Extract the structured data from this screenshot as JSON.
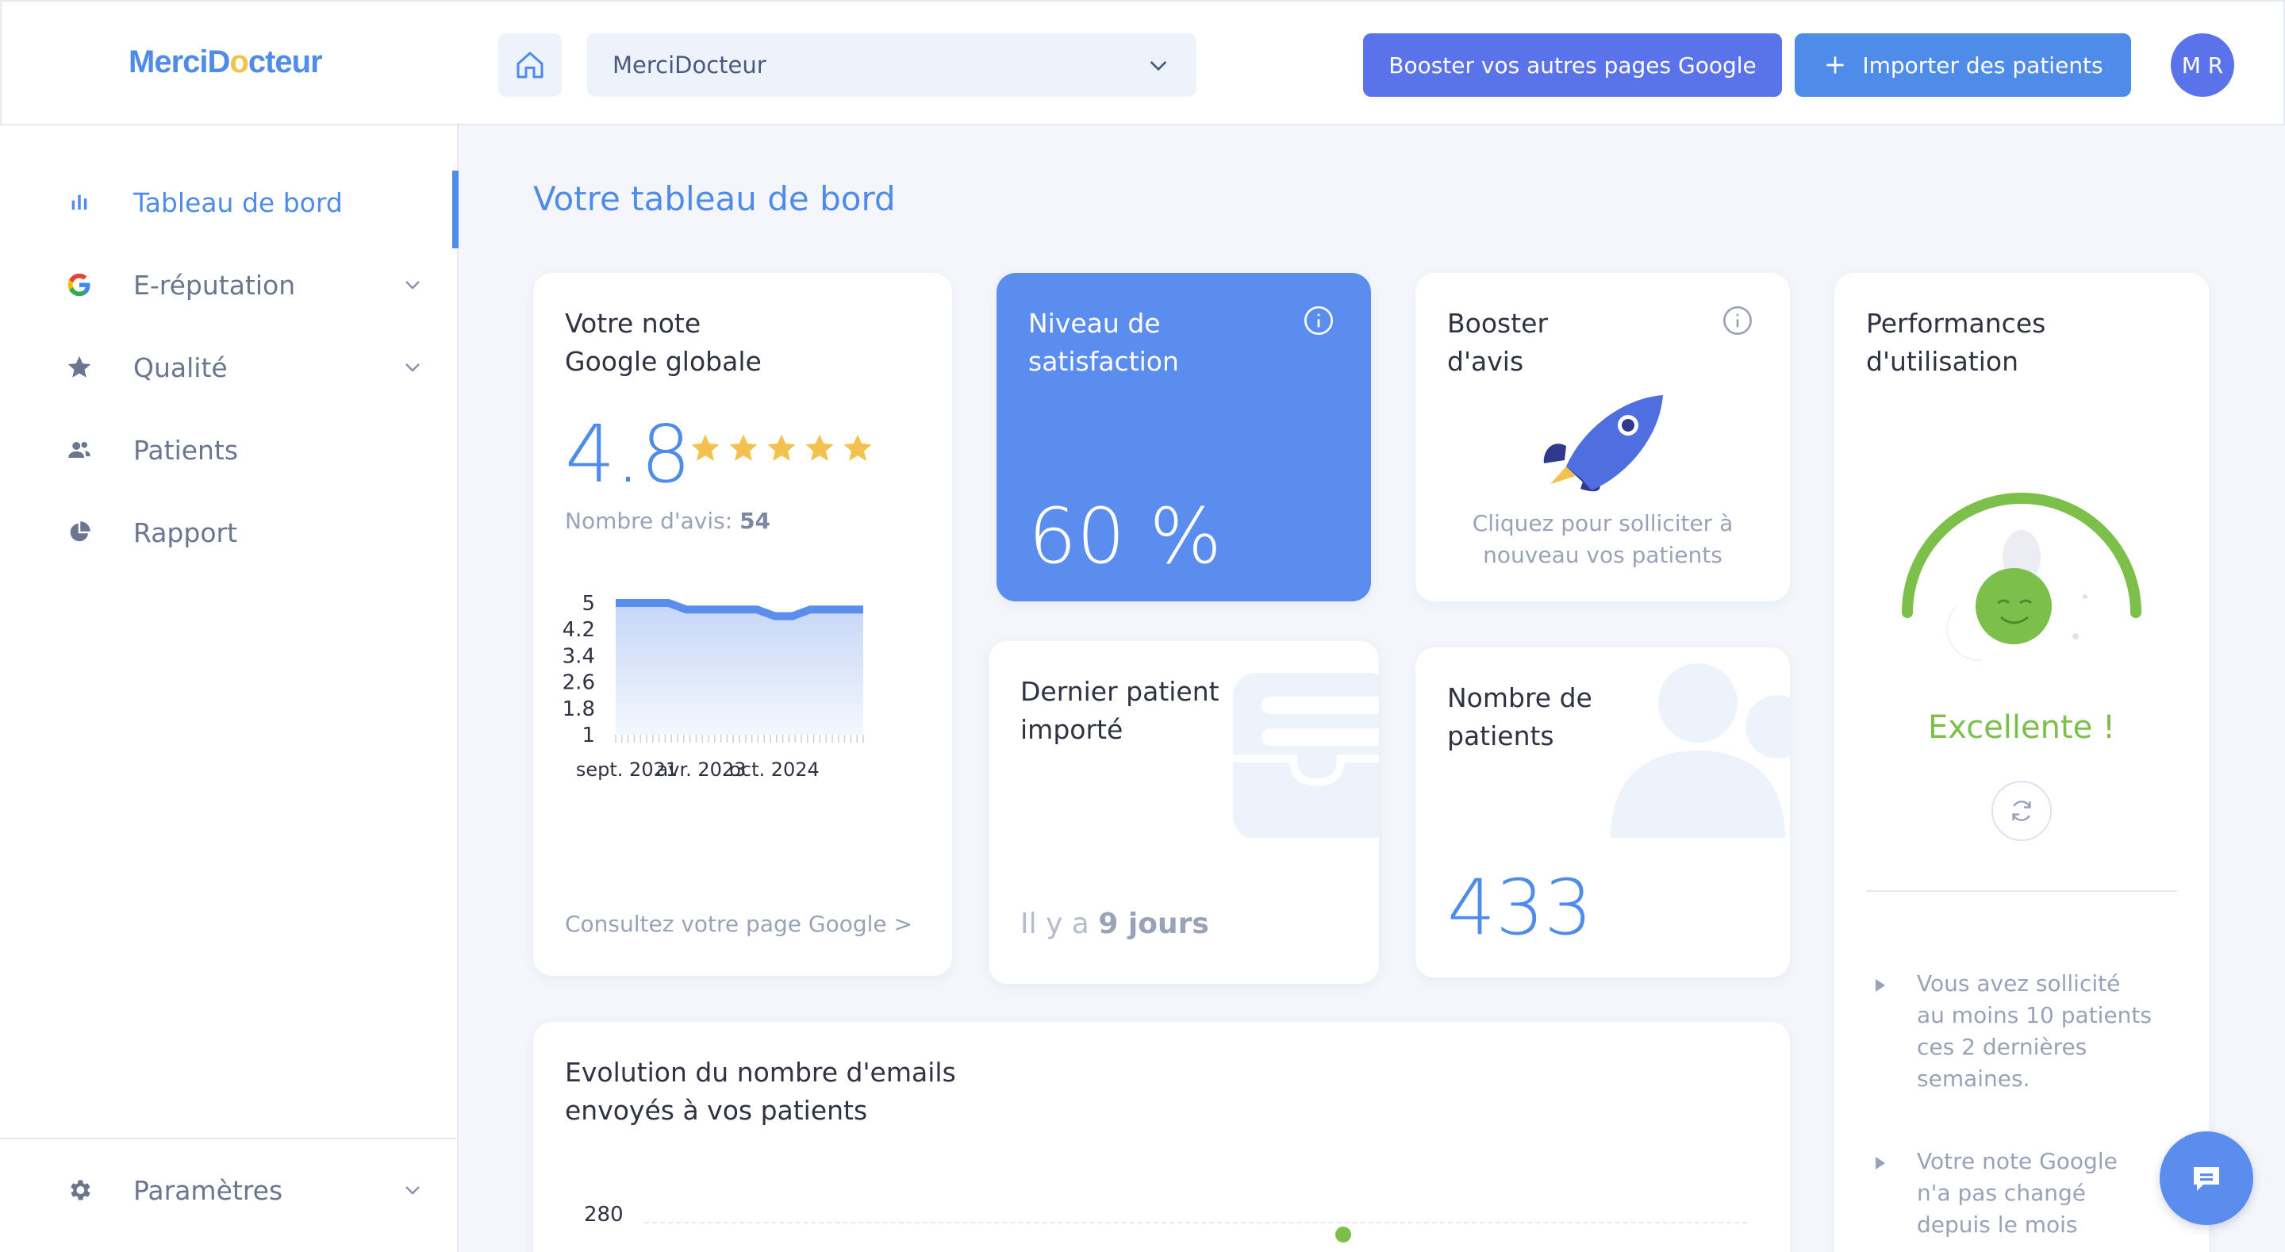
{
  "brand": {
    "name_left": "MerciD",
    "name_star": "o",
    "name_right": "cteur",
    "accent": "#4f8be8",
    "primary": "#5a73ea"
  },
  "header": {
    "home_icon": "home-icon",
    "select_value": "MerciDocteur",
    "boost_label": "Booster vos autres pages Google",
    "import_label": "Importer des patients",
    "avatar_initials": "M R"
  },
  "sidebar": {
    "items": [
      {
        "label": "Tableau de bord",
        "icon": "bar-chart-icon",
        "active": true
      },
      {
        "label": "E-réputation",
        "icon": "google-icon",
        "expandable": true
      },
      {
        "label": "Qualité",
        "icon": "star-icon",
        "expandable": true
      },
      {
        "label": "Patients",
        "icon": "users-icon"
      },
      {
        "label": "Rapport",
        "icon": "pie-chart-icon"
      }
    ],
    "footer": {
      "label": "Paramètres",
      "icon": "gear-icon"
    }
  },
  "main": {
    "title": "Votre tableau de bord",
    "note_card": {
      "title_line1": "Votre note",
      "title_line2": "Google globale",
      "value": "4.8",
      "stars": 5,
      "count_label": "Nombre d'avis: ",
      "count_value": "54",
      "link": "Consultez votre page Google >"
    },
    "satisfaction_card": {
      "title_line1": "Niveau de",
      "title_line2": "satisfaction",
      "value": "60 %"
    },
    "booster_card": {
      "title_line1": "Booster",
      "title_line2": "d'avis",
      "text_line1": "Cliquez pour solliciter à",
      "text_line2": "nouveau vos patients"
    },
    "dernier_card": {
      "title_line1": "Dernier patient",
      "title_line2": "importé",
      "prefix": "Il y a ",
      "value": "9 jours"
    },
    "nombre_card": {
      "title_line1": "Nombre de",
      "title_line2": "patients",
      "value": "433"
    },
    "perf_card": {
      "title_line1": "Performances",
      "title_line2": "d'utilisation",
      "status": "Excellente !",
      "items": [
        {
          "lines": [
            "Vous avez sollicité",
            "au moins 10 patients",
            "ces 2 dernières",
            "semaines."
          ]
        },
        {
          "lines": [
            "Votre note Google",
            "n'a pas changé",
            "depuis le mois"
          ]
        }
      ]
    },
    "emails_card": {
      "title_line1": "Evolution du nombre d'emails",
      "title_line2": "envoyés à vos patients",
      "ytick_top": "280"
    }
  },
  "chart_data": [
    {
      "type": "area",
      "x_tick_labels": [
        "sept. 2021",
        "avr. 2023",
        "oct. 2024"
      ],
      "y_ticks": [
        "5",
        "4.2",
        "3.4",
        "2.6",
        "1.8",
        "1"
      ],
      "ylim": [
        1,
        5
      ],
      "series": [
        {
          "values": [
            5,
            5,
            5,
            5,
            4.8,
            4.8,
            4.8,
            4.8,
            4.8,
            4.6,
            4.6,
            4.8,
            4.8,
            4.8,
            4.8
          ]
        }
      ],
      "colors": {
        "line": "#5b8def",
        "fill_top": "#c5d6f7",
        "fill_bottom": "#f4f7fd"
      }
    }
  ]
}
